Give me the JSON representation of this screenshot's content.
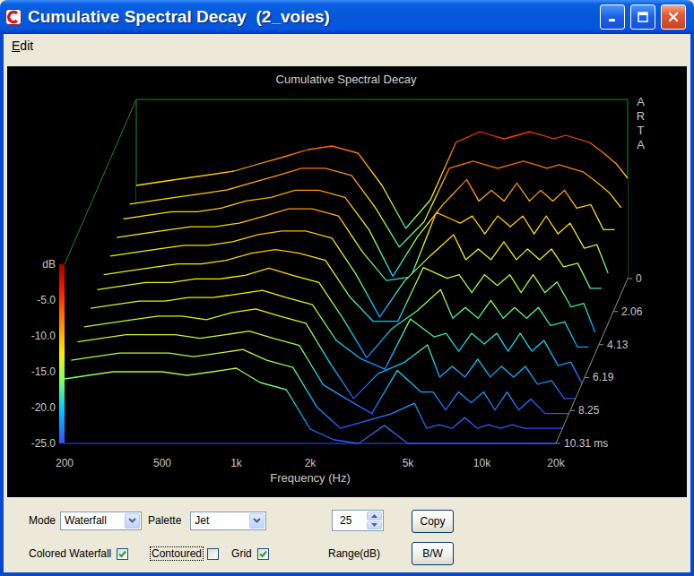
{
  "window": {
    "title": "Cumulative Spectral Decay  (2_voies)"
  },
  "menu": [
    {
      "label": "Edit"
    }
  ],
  "chart": {
    "title": "Cumulative Spectral Decay",
    "watermark": "ARTA",
    "y_axis": {
      "unit": "dB",
      "ticks": [
        "-5.0",
        "-10.0",
        "-15.0",
        "-20.0",
        "-25.0"
      ]
    },
    "x_axis": {
      "label": "Frequency (Hz)",
      "ticks": [
        "200",
        "500",
        "1k",
        "2k",
        "5k",
        "10k",
        "20k"
      ]
    },
    "time_axis": {
      "ticks": [
        "0",
        "2.06",
        "4.13",
        "6.19",
        "8.25",
        "10.31 ms"
      ]
    },
    "frequencies_hz": [
      200,
      250,
      315,
      400,
      500,
      630,
      800,
      1000,
      1250,
      1600,
      2000,
      2500,
      3150,
      4000,
      5000,
      5600,
      6300,
      7100,
      8000,
      9000,
      10000,
      11200,
      12500,
      14000,
      16000,
      18000,
      20000
    ],
    "slices": [
      {
        "t_ms": 0,
        "values": [
          -12,
          -11.5,
          -11,
          -10.5,
          -10,
          -9,
          -8,
          -7,
          -6.5,
          -7.5,
          -12,
          -18,
          -14,
          -6,
          -4.5,
          -5,
          -5.5,
          -5,
          -4.5,
          -5,
          -5.5,
          -5,
          -5.5,
          -6,
          -7.5,
          -9,
          -11
        ]
      },
      {
        "t_ms": 0.94,
        "values": [
          -12.5,
          -12,
          -11.5,
          -11,
          -10.5,
          -9.5,
          -8.5,
          -7.5,
          -7.5,
          -8.5,
          -13,
          -18.5,
          -15,
          -7.5,
          -6.5,
          -7,
          -7.5,
          -7,
          -6.5,
          -7,
          -7.5,
          -7,
          -7.5,
          -8,
          -9.5,
          -11,
          -13
        ]
      },
      {
        "t_ms": 1.87,
        "values": [
          -12.5,
          -12,
          -11.5,
          -11.5,
          -11,
          -10,
          -9.5,
          -8.5,
          -8.5,
          -9.5,
          -14,
          -20.5,
          -15,
          -10.5,
          -7,
          -10,
          -8.5,
          -10,
          -7.5,
          -10,
          -8.5,
          -10,
          -8.5,
          -11,
          -10.5,
          -14,
          -14
        ]
      },
      {
        "t_ms": 2.81,
        "values": [
          -13,
          -12.5,
          -12,
          -11.5,
          -11.5,
          -11,
          -10,
          -9,
          -9,
          -10,
          -15,
          -19,
          -18.5,
          -9.5,
          -11,
          -10,
          -12.5,
          -10,
          -11.5,
          -10,
          -12.5,
          -10,
          -12.5,
          -11,
          -14.5,
          -14,
          -18
        ]
      },
      {
        "t_ms": 3.75,
        "values": [
          -13.5,
          -13,
          -12.5,
          -12,
          -12,
          -11.5,
          -10.5,
          -10,
          -10,
          -11,
          -16,
          -22,
          -17,
          -13.5,
          -10.5,
          -14,
          -12.5,
          -14,
          -11.5,
          -14,
          -12.5,
          -14,
          -12.5,
          -15,
          -14.5,
          -18,
          -18
        ]
      },
      {
        "t_ms": 4.69,
        "values": [
          -14,
          -13.5,
          -13,
          -12.5,
          -12.5,
          -12,
          -11,
          -10.5,
          -11,
          -12,
          -17,
          -20.5,
          -20.5,
          -13,
          -14.5,
          -14,
          -16.5,
          -14,
          -15.5,
          -14,
          -16.5,
          -14,
          -16.5,
          -15,
          -18.5,
          -18,
          -22
        ]
      },
      {
        "t_ms": 5.62,
        "values": [
          -14,
          -13.5,
          -13,
          -13,
          -12.5,
          -12.5,
          -12,
          -11,
          -12,
          -13,
          -18,
          -23.5,
          -19.5,
          -17,
          -14,
          -18,
          -16.5,
          -18,
          -15.5,
          -18,
          -16.5,
          -18,
          -16.5,
          -19,
          -18.5,
          -22,
          -22
        ]
      },
      {
        "t_ms": 6.56,
        "values": [
          -14.5,
          -14,
          -13.5,
          -13.5,
          -13,
          -13,
          -12.5,
          -12,
          -13,
          -14,
          -19,
          -21.5,
          -23,
          -16,
          -18.5,
          -18,
          -20.5,
          -18,
          -19.5,
          -18,
          -20.5,
          -18,
          -20.5,
          -19,
          -22.5,
          -22,
          -25
        ]
      },
      {
        "t_ms": 7.5,
        "values": [
          -15,
          -14.5,
          -14,
          -13.5,
          -13.5,
          -14,
          -13,
          -12.5,
          -13.5,
          -14.5,
          -20,
          -25,
          -21.5,
          -20,
          -17.5,
          -22,
          -20.5,
          -22,
          -19.5,
          -22,
          -20.5,
          -22,
          -20.5,
          -23,
          -22.5,
          -25,
          -25
        ]
      },
      {
        "t_ms": 8.44,
        "values": [
          -15,
          -14.5,
          -14,
          -14,
          -14,
          -14.5,
          -14,
          -13.5,
          -14.5,
          -15.5,
          -21,
          -23,
          -25,
          -19,
          -22,
          -22,
          -24.5,
          -22,
          -23.5,
          -22,
          -24.5,
          -22,
          -24.5,
          -23,
          -25,
          -25,
          -25
        ]
      },
      {
        "t_ms": 9.37,
        "values": [
          -15.5,
          -15,
          -14.5,
          -14.5,
          -14.5,
          -15,
          -14.5,
          -14,
          -15.5,
          -16.5,
          -22,
          -25,
          -24,
          -23,
          -21.5,
          -25,
          -24.5,
          -25,
          -23.5,
          -25,
          -24.5,
          -25,
          -24.5,
          -25,
          -25,
          -25,
          -25
        ]
      },
      {
        "t_ms": 10.31,
        "values": [
          -16,
          -15.5,
          -15,
          -15,
          -15,
          -15.5,
          -15,
          -14.5,
          -16.5,
          -17.5,
          -23,
          -24.5,
          -25,
          -22.5,
          -25,
          -25,
          -25,
          -25,
          -25,
          -25,
          -25,
          -25,
          -25,
          -25,
          -25,
          -25,
          -25
        ]
      }
    ]
  },
  "controls": {
    "mode": {
      "label": "Mode",
      "value": "Waterfall"
    },
    "palette": {
      "label": "Palette",
      "value": "Jet"
    },
    "range": {
      "label": "Range(dB)",
      "value": "25"
    },
    "checkboxes": [
      {
        "label": "Colored Waterfall",
        "checked": true,
        "focused": false
      },
      {
        "label": "Contoured",
        "checked": false,
        "focused": true
      },
      {
        "label": "Grid",
        "checked": true,
        "focused": false
      }
    ],
    "buttons": [
      "Copy",
      "B/W"
    ]
  }
}
